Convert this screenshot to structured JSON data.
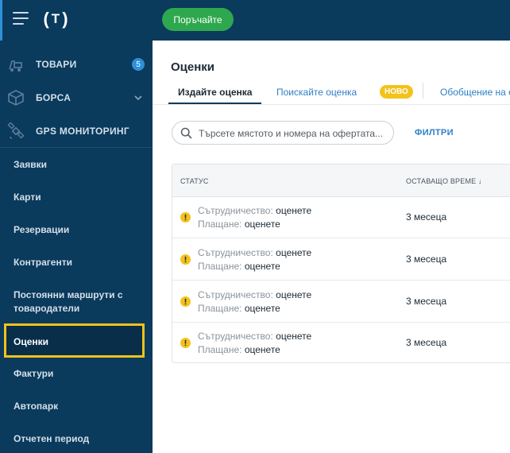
{
  "topbar": {
    "order_button": "Поръчайте",
    "logo_letter": "T"
  },
  "sidebar": {
    "main_items": [
      {
        "label": "ТОВАРИ",
        "badge": "5",
        "icon": "truck-icon"
      },
      {
        "label": "БОРСА",
        "icon": "box-icon",
        "expand_icon": "chevron-down-icon"
      },
      {
        "label": "GPS МОНИТОРИНГ",
        "icon": "satellite-icon"
      }
    ],
    "sub_items": [
      {
        "label": "Заявки"
      },
      {
        "label": "Карти"
      },
      {
        "label": "Резервации"
      },
      {
        "label": "Контрагенти"
      },
      {
        "label_line1": "Постоянни маршрути с",
        "label_line2": "товародатели"
      },
      {
        "label": "Оценки",
        "active": true
      },
      {
        "label": "Фактури"
      },
      {
        "label": "Автопарк"
      },
      {
        "label": "Отчетен период"
      }
    ]
  },
  "main": {
    "title": "Оценки",
    "tabs": [
      {
        "label": "Издайте оценка",
        "active": true
      },
      {
        "label": "Поискайте оценка",
        "pill": "НОВО"
      },
      {
        "label": "Обобщение на оце"
      }
    ],
    "search": {
      "placeholder": "Търсете мястото и номера на офертата..."
    },
    "filters_label": "ФИЛТРИ",
    "table": {
      "columns": {
        "status": "СТАТУС",
        "remaining": "ОСТАВАЩО ВРЕМЕ ↓"
      },
      "rows": [
        {
          "coop_key": "Сътрудничество:",
          "coop_val": "оценете",
          "pay_key": "Плащане:",
          "pay_val": "оценете",
          "remaining": "3 месеца"
        },
        {
          "coop_key": "Сътрудничество:",
          "coop_val": "оценете",
          "pay_key": "Плащане:",
          "pay_val": "оценете",
          "remaining": "3 месеца"
        },
        {
          "coop_key": "Сътрудничество:",
          "coop_val": "оценете",
          "pay_key": "Плащане:",
          "pay_val": "оценете",
          "remaining": "3 месеца"
        },
        {
          "coop_key": "Сътрудничество:",
          "coop_val": "оценете",
          "pay_key": "Плащане:",
          "pay_val": "оценете",
          "remaining": "3 месеца"
        }
      ]
    }
  },
  "colors": {
    "sidebar_bg": "#0a3a5c",
    "accent_green": "#2ea84e",
    "highlight_yellow": "#f3c21b",
    "link_blue": "#2f7fc4",
    "badge_blue": "#2f8fd8"
  }
}
